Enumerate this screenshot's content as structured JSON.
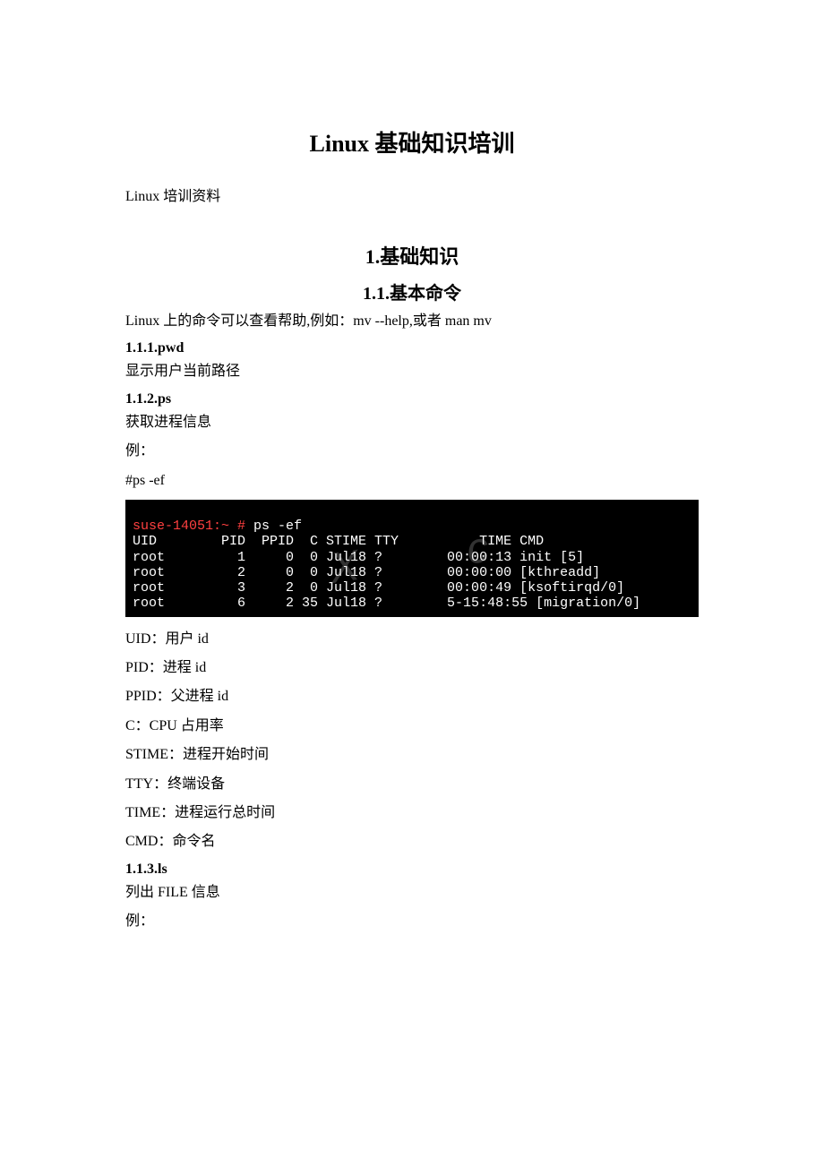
{
  "title": "Linux 基础知识培训",
  "subtitle": "Linux 培训资料",
  "section1": "1.基础知识",
  "section1_1": "1.1.基本命令",
  "intro": "Linux 上的命令可以查看帮助,例如：mv --help,或者 man mv",
  "s111": "1.1.1.pwd",
  "s111_body": "显示用户当前路径",
  "s112": "1.1.2.ps",
  "s112_body": "获取进程信息",
  "example_label": "例：",
  "ps_cmd": "#ps -ef",
  "terminal": {
    "prompt_host": "suse-14051:~ #",
    "prompt_cmd": " ps -ef",
    "header": "UID        PID  PPID  C STIME TTY          TIME CMD",
    "rows": [
      "root         1     0  0 Jul18 ?        00:00:13 init [5]",
      "root         2     0  0 Jul18 ?        00:00:00 [kthreadd]",
      "root         3     2  0 Jul18 ?        00:00:49 [ksoftirqd/0]",
      "root         6     2 35 Jul18 ?        5-15:48:55 [migration/0]"
    ],
    "watermark": "X      c"
  },
  "defs": {
    "uid": "UID：用户 id",
    "pid": "PID：进程 id",
    "ppid": "PPID：父进程 id",
    "c": "C：CPU 占用率",
    "stime": "STIME：进程开始时间",
    "tty": "TTY：终端设备",
    "time": "TIME：进程运行总时间",
    "cmd": "CMD：命令名"
  },
  "s113": "1.1.3.ls",
  "s113_body": "列出 FILE 信息",
  "example_label2": "例："
}
